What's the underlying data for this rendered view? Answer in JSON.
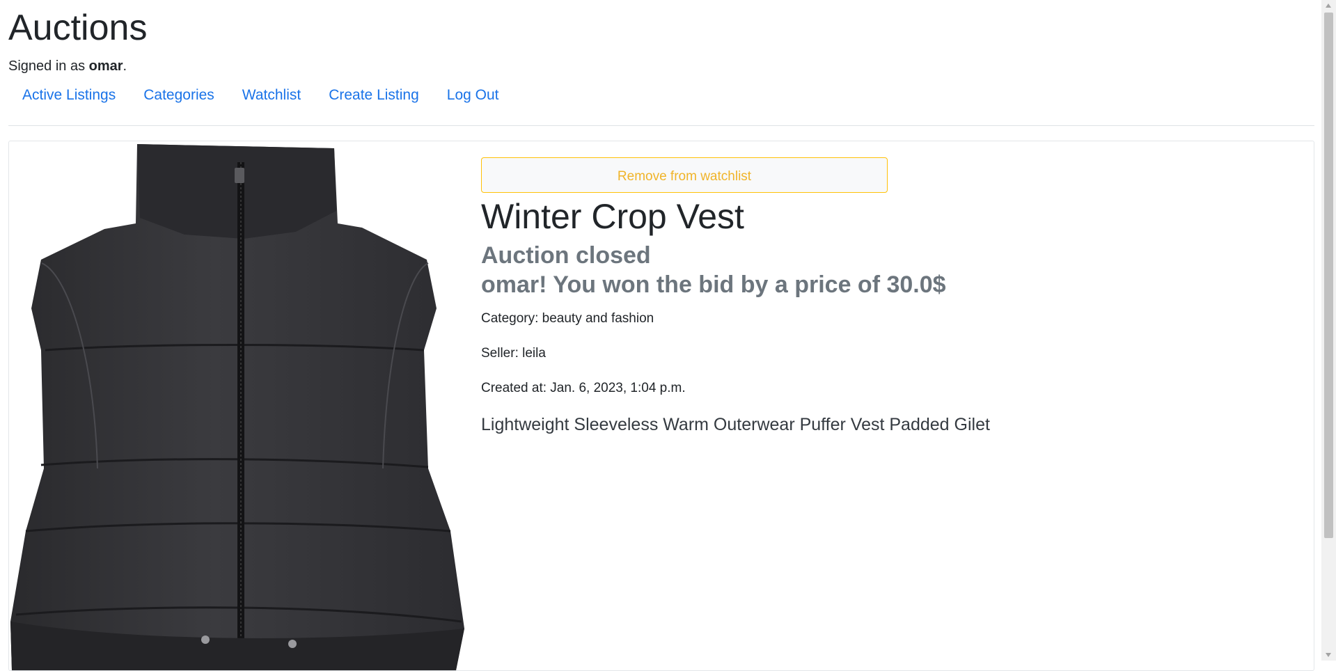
{
  "header": {
    "title": "Auctions",
    "signed_in_prefix": "Signed in as ",
    "username": "omar",
    "signed_in_suffix": "."
  },
  "nav": {
    "items": [
      {
        "label": "Active Listings"
      },
      {
        "label": "Categories"
      },
      {
        "label": "Watchlist"
      },
      {
        "label": "Create Listing"
      },
      {
        "label": "Log Out"
      }
    ]
  },
  "listing": {
    "watch_button": "Remove from watchlist",
    "title": "Winter Crop Vest",
    "status": "Auction closed",
    "winner_message": "omar! You won the bid by a price of 30.0$",
    "category": "Category: beauty and fashion",
    "seller": "Seller: leila",
    "created": "Created at: Jan. 6, 2023, 1:04 p.m.",
    "description": "Lightweight Sleeveless Warm Outerwear Puffer Vest Padded Gilet",
    "image_icon": "black-puffer-vest-image"
  },
  "colors": {
    "link": "#1a73e8",
    "warning": "#ffc107",
    "muted": "#6c757d"
  }
}
